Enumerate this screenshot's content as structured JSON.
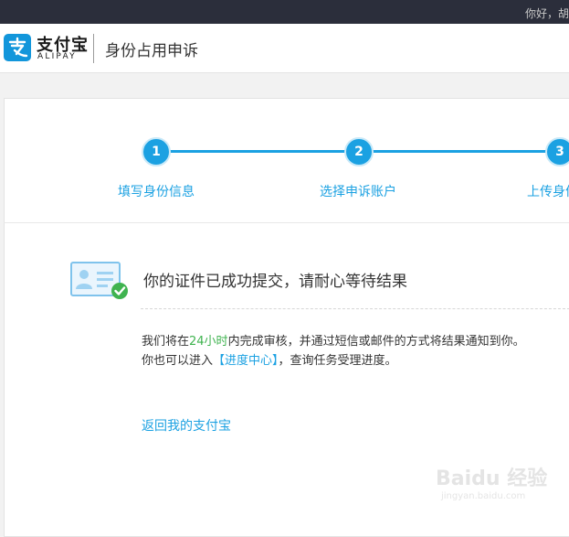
{
  "topbar": {
    "greeting": "你好，胡"
  },
  "header": {
    "logo_cn": "支付宝",
    "logo_en": "ALIPAY",
    "title": "身份占用申诉"
  },
  "steps": [
    {
      "number": "1",
      "label": "填写身份信息"
    },
    {
      "number": "2",
      "label": "选择申诉账户"
    },
    {
      "number": "3",
      "label": "上传身份"
    }
  ],
  "result": {
    "title": "你的证件已成功提交，请耐心等待结果",
    "line1_before": "我们将在",
    "line1_highlight": "24小时",
    "line1_after": "内完成审核，并通过短信或邮件的方式将结果通知到你。",
    "line2_before": "你也可以进入",
    "line2_link": "【进度中心】",
    "line2_after": "，查询任务受理进度。"
  },
  "back_link": "返回我的支付宝",
  "watermark": {
    "line1": "Baidu 经验",
    "line2": "jingyan.baidu.com"
  },
  "colors": {
    "accent": "#1ba1e2",
    "success": "#3fb34f",
    "topbar": "#2b2e3b"
  }
}
